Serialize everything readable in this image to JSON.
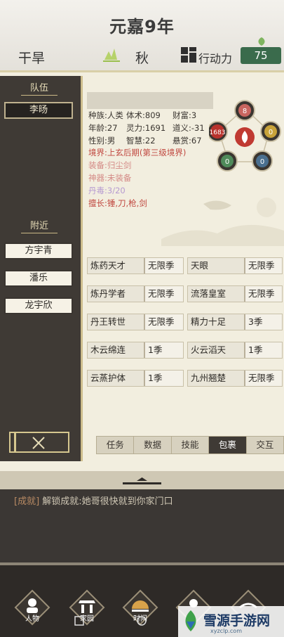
{
  "header": {
    "year": "元嘉9年",
    "weather": "干旱",
    "season": "秋",
    "action_label": "行动力",
    "action_value": "75"
  },
  "sidebar": {
    "team_header": "队伍",
    "team_member": "李旸",
    "nearby_header": "附近",
    "nearby": [
      "方宇青",
      "潘乐",
      "龙宇欣"
    ]
  },
  "character": {
    "stats": {
      "race": "种族:人类",
      "physique": "体术:809",
      "wealth": "财富:3",
      "age": "年龄:27",
      "spirit": "灵力:1691",
      "morality": "道义:-31",
      "gender": "性别:男",
      "wisdom": "智慧:22",
      "bounty": "悬赏:67"
    },
    "realm": "境界:上玄后期(第三级境界)",
    "equipment": "装备:归尘剑",
    "artifact": "神器:未装备",
    "pill_poison": "丹毒:3/20",
    "specialty": "擅长:锤,刀,枪,剑"
  },
  "elements": {
    "top": "8",
    "left": "1683",
    "right": "0",
    "bottom_left": "0",
    "bottom_right": "0"
  },
  "traits": [
    {
      "name": "炼药天才",
      "duration": "无限季"
    },
    {
      "name": "天眼",
      "duration": "无限季"
    },
    {
      "name": "炼丹学者",
      "duration": "无限季"
    },
    {
      "name": "流落皇室",
      "duration": "无限季"
    },
    {
      "name": "丹王转世",
      "duration": "无限季"
    },
    {
      "name": "精力十足",
      "duration": "3季"
    },
    {
      "name": "木云绵连",
      "duration": "1季"
    },
    {
      "name": "火云滔天",
      "duration": "1季"
    },
    {
      "name": "云蒸护体",
      "duration": "1季"
    },
    {
      "name": "九州翘楚",
      "duration": "无限季"
    }
  ],
  "tabs": [
    "任务",
    "数据",
    "技能",
    "包裹",
    "交互"
  ],
  "log": {
    "tag": "[成就]",
    "text": "解锁成就:她哥很快就到你家门口"
  },
  "nav": [
    "人物",
    "家园",
    "时间"
  ],
  "watermark": {
    "brand": "雪源手游网",
    "url": "xyzclp.com"
  }
}
